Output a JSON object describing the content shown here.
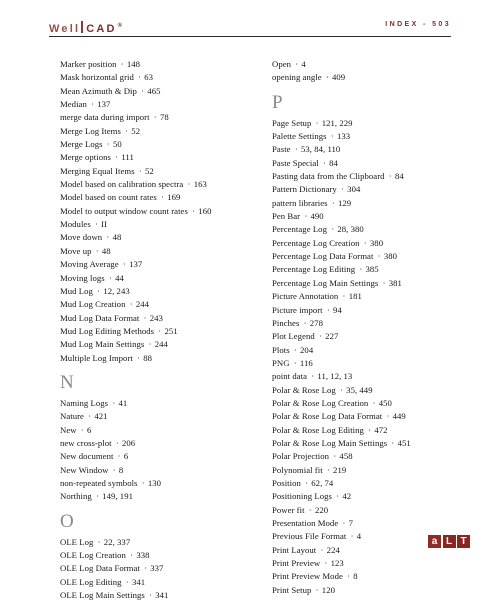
{
  "header": {
    "brand_well": "Well",
    "brand_cad": "CAD",
    "brand_tm": "®",
    "index_label": "INDEX - 503"
  },
  "columns": {
    "left": [
      {
        "type": "entry",
        "term": "Marker position",
        "pages": "148"
      },
      {
        "type": "entry",
        "term": "Mask horizontal grid",
        "pages": "63"
      },
      {
        "type": "entry",
        "term": "Mean Azimuth & Dip",
        "pages": "465"
      },
      {
        "type": "entry",
        "term": "Median",
        "pages": "137"
      },
      {
        "type": "entry",
        "term": "merge data during import",
        "pages": "78"
      },
      {
        "type": "entry",
        "term": "Merge Log Items",
        "pages": "52"
      },
      {
        "type": "entry",
        "term": "Merge Logs",
        "pages": "50"
      },
      {
        "type": "entry",
        "term": "Merge options",
        "pages": "111"
      },
      {
        "type": "entry",
        "term": "Merging Equal Items",
        "pages": "52"
      },
      {
        "type": "entry",
        "term": "Model based on calibration spectra",
        "pages": "163"
      },
      {
        "type": "entry",
        "term": "Model based on count rates",
        "pages": "169"
      },
      {
        "type": "entry",
        "term": "Model to output window count rates",
        "pages": "160"
      },
      {
        "type": "entry",
        "term": "Modules",
        "pages": "II"
      },
      {
        "type": "entry",
        "term": "Move down",
        "pages": "48"
      },
      {
        "type": "entry",
        "term": "Move up",
        "pages": "48"
      },
      {
        "type": "entry",
        "term": "Moving Average",
        "pages": "137"
      },
      {
        "type": "entry",
        "term": "Moving logs",
        "pages": "44"
      },
      {
        "type": "entry",
        "term": "Mud Log",
        "pages": "12, 243"
      },
      {
        "type": "entry",
        "term": "Mud Log Creation",
        "pages": "244"
      },
      {
        "type": "entry",
        "term": "Mud Log Data Format",
        "pages": "243"
      },
      {
        "type": "entry",
        "term": "Mud Log Editing Methods",
        "pages": "251"
      },
      {
        "type": "entry",
        "term": "Mud Log Main Settings",
        "pages": "244"
      },
      {
        "type": "entry",
        "term": "Multiple Log Import",
        "pages": "88"
      },
      {
        "type": "letter",
        "letter": "N"
      },
      {
        "type": "entry",
        "term": "Naming Logs",
        "pages": "41"
      },
      {
        "type": "entry",
        "term": "Nature",
        "pages": "421"
      },
      {
        "type": "entry",
        "term": "New",
        "pages": "6"
      },
      {
        "type": "entry",
        "term": "new cross-plot",
        "pages": "206"
      },
      {
        "type": "entry",
        "term": "New document",
        "pages": "6"
      },
      {
        "type": "entry",
        "term": "New Window",
        "pages": "8"
      },
      {
        "type": "entry",
        "term": "non-repeated symbols",
        "pages": "130"
      },
      {
        "type": "entry",
        "term": "Northing",
        "pages": "149, 191"
      },
      {
        "type": "letter",
        "letter": "O"
      },
      {
        "type": "entry",
        "term": "OLE Log",
        "pages": "22, 337"
      },
      {
        "type": "entry",
        "term": "OLE Log Creation",
        "pages": "338"
      },
      {
        "type": "entry",
        "term": "OLE Log Data Format",
        "pages": "337"
      },
      {
        "type": "entry",
        "term": "OLE Log Editing",
        "pages": "341"
      },
      {
        "type": "entry",
        "term": "OLE Log Main Settings",
        "pages": "341"
      }
    ],
    "right": [
      {
        "type": "entry",
        "term": "Open",
        "pages": "4"
      },
      {
        "type": "entry",
        "term": "opening angle",
        "pages": "409"
      },
      {
        "type": "letter",
        "letter": "P"
      },
      {
        "type": "entry",
        "term": "Page Setup",
        "pages": "121, 229"
      },
      {
        "type": "entry",
        "term": "Palette Settings",
        "pages": "133"
      },
      {
        "type": "entry",
        "term": "Paste",
        "pages": "53, 84, 110"
      },
      {
        "type": "entry",
        "term": "Paste Special",
        "pages": "84"
      },
      {
        "type": "entry",
        "term": "Pasting data from the Clipboard",
        "pages": "84"
      },
      {
        "type": "entry",
        "term": "Pattern Dictionary",
        "pages": "304"
      },
      {
        "type": "entry",
        "term": "pattern libraries",
        "pages": "129"
      },
      {
        "type": "entry",
        "term": "Pen Bar",
        "pages": "490"
      },
      {
        "type": "entry",
        "term": "Percentage Log",
        "pages": "28, 380"
      },
      {
        "type": "entry",
        "term": "Percentage Log Creation",
        "pages": "380"
      },
      {
        "type": "entry",
        "term": "Percentage Log Data Format",
        "pages": "380"
      },
      {
        "type": "entry",
        "term": "Percentage Log Editing",
        "pages": "385"
      },
      {
        "type": "entry",
        "term": "Percentage Log Main Settings",
        "pages": "381"
      },
      {
        "type": "entry",
        "term": "Picture Annotation",
        "pages": "181"
      },
      {
        "type": "entry",
        "term": "Picture import",
        "pages": "94"
      },
      {
        "type": "entry",
        "term": "Pinches",
        "pages": "278"
      },
      {
        "type": "entry",
        "term": "Plot Legend",
        "pages": "227"
      },
      {
        "type": "entry",
        "term": "Plots",
        "pages": "204"
      },
      {
        "type": "entry",
        "term": "PNG",
        "pages": "116"
      },
      {
        "type": "entry",
        "term": "point data",
        "pages": "11, 12, 13"
      },
      {
        "type": "entry",
        "term": "Polar & Rose Log",
        "pages": "35, 449"
      },
      {
        "type": "entry",
        "term": "Polar & Rose Log Creation",
        "pages": "450"
      },
      {
        "type": "entry",
        "term": "Polar & Rose Log Data Format",
        "pages": "449"
      },
      {
        "type": "entry",
        "term": "Polar & Rose Log Editing",
        "pages": "472"
      },
      {
        "type": "entry",
        "term": "Polar & Rose Log Main Settings",
        "pages": "451"
      },
      {
        "type": "entry",
        "term": "Polar Projection",
        "pages": "458"
      },
      {
        "type": "entry",
        "term": "Polynomial fit",
        "pages": "219"
      },
      {
        "type": "entry",
        "term": "Position",
        "pages": "62, 74"
      },
      {
        "type": "entry",
        "term": "Positioning Logs",
        "pages": "42"
      },
      {
        "type": "entry",
        "term": "Power fit",
        "pages": "220"
      },
      {
        "type": "entry",
        "term": "Presentation Mode",
        "pages": "7"
      },
      {
        "type": "entry",
        "term": "Previous File Format",
        "pages": "4"
      },
      {
        "type": "entry",
        "term": "Print Layout",
        "pages": "224"
      },
      {
        "type": "entry",
        "term": "Print Preview",
        "pages": "123"
      },
      {
        "type": "entry",
        "term": "Print Preview Mode",
        "pages": "8"
      },
      {
        "type": "entry",
        "term": "Print Setup",
        "pages": "120"
      }
    ]
  },
  "footer": {
    "logo_a": "a",
    "logo_l": "L",
    "logo_t": "T"
  },
  "separator": "·",
  "colors": {
    "brand": "#8c3a35",
    "index_label": "#7e2f2b",
    "rule": "#2b2b2b",
    "section_letter": "#8a8a8a",
    "footer_logo": "#8a2622",
    "text": "#17171a"
  }
}
